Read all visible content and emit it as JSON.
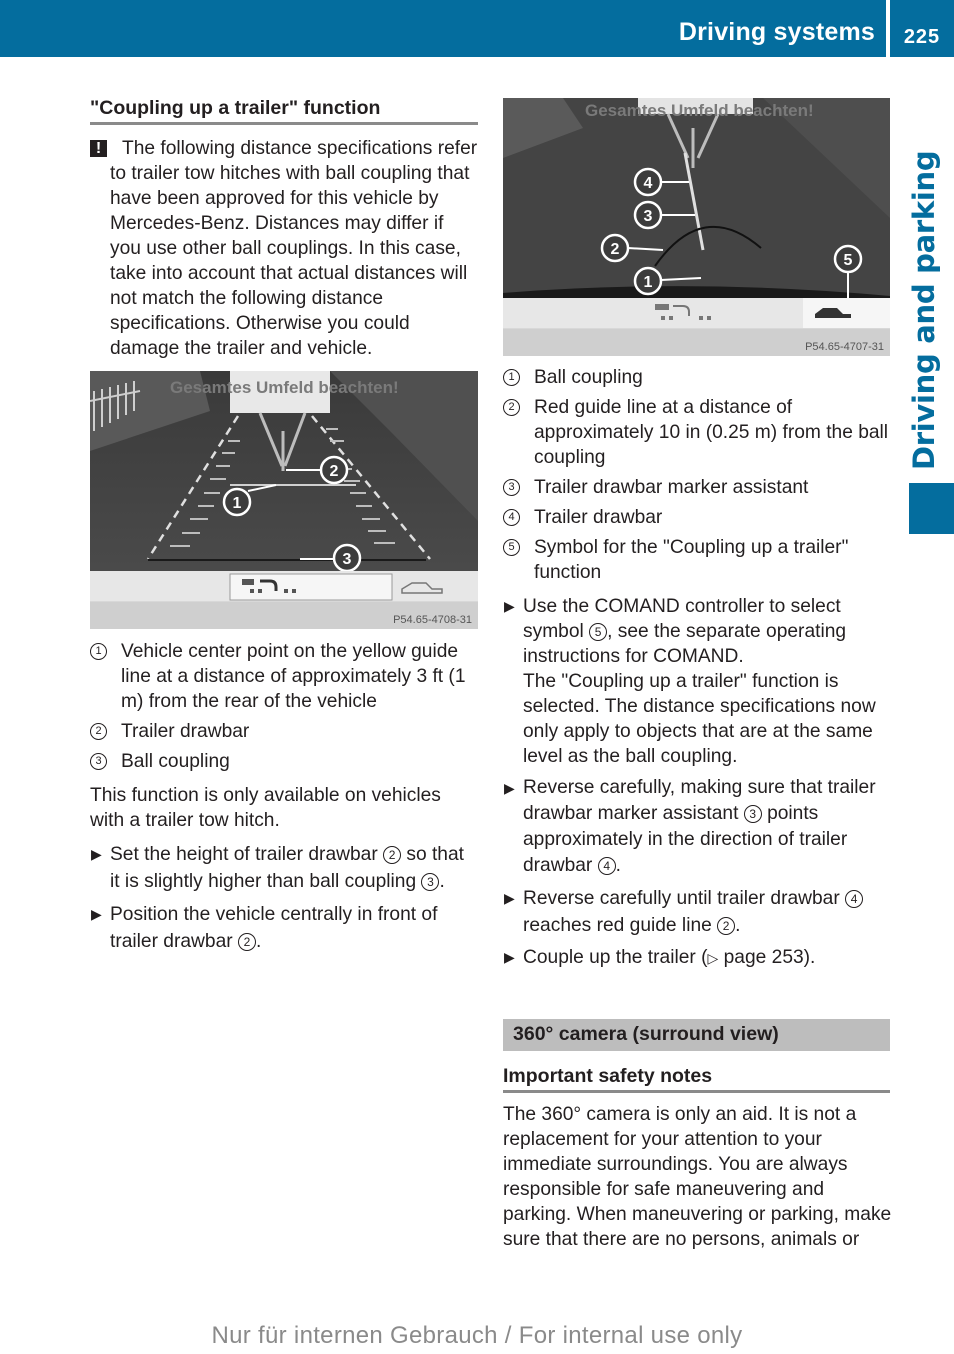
{
  "header": {
    "section_title": "Driving systems",
    "page_number": "225",
    "side_tab": "Driving and parking"
  },
  "left": {
    "heading": "\"Coupling up a trailer\" function",
    "warning_icon": "!",
    "warning_text": "The following distance specifications refer to trailer tow hitches with ball coupling that have been approved for this vehicle by Mercedes-Benz. Distances may differ if you use other ball couplings. In this case, take into account that actual distances will not match the following distance specifications. Otherwise you could damage the trailer and vehicle.",
    "figure": {
      "overlay_text": "Gesamtes Umfeld beachten!",
      "figure_code": "P54.65-4708-31",
      "callouts": [
        "1",
        "2",
        "3"
      ]
    },
    "legend": [
      {
        "num": "1",
        "text": "Vehicle center point on the yellow guide line at a distance of approximately 3 ft (1 m) from the rear of the vehicle"
      },
      {
        "num": "2",
        "text": "Trailer drawbar"
      },
      {
        "num": "3",
        "text": "Ball coupling"
      }
    ],
    "intro": "This function is only available on vehicles with a trailer tow hitch.",
    "steps": [
      {
        "before": "Set the height of trailer drawbar ",
        "ref1": "2",
        "middle": " so that it is slightly higher than ball coupling ",
        "ref2": "3",
        "after": "."
      },
      {
        "before": "Position the vehicle centrally in front of trailer drawbar ",
        "ref1": "2",
        "after": "."
      }
    ]
  },
  "right": {
    "figure": {
      "overlay_text": "Gesamtes Umfeld beachten!",
      "figure_code": "P54.65-4707-31",
      "callouts": [
        "1",
        "2",
        "3",
        "4",
        "5"
      ]
    },
    "legend": [
      {
        "num": "1",
        "text": "Ball coupling"
      },
      {
        "num": "2",
        "text": "Red guide line at a distance of approximately 10 in (0.25 m) from the ball coupling"
      },
      {
        "num": "3",
        "text": "Trailer drawbar marker assistant"
      },
      {
        "num": "4",
        "text": "Trailer drawbar"
      },
      {
        "num": "5",
        "text": "Symbol for the \"Coupling up a trailer\" function"
      }
    ],
    "steps": [
      {
        "before": "Use the COMAND controller to select symbol ",
        "ref1": "5",
        "after": ", see the separate operating instructions for COMAND.",
        "result": "The \"Coupling up a trailer\" function is selected. The distance specifications now only apply to objects that are at the same level as the ball coupling."
      },
      {
        "before": "Reverse carefully, making sure that trailer drawbar marker assistant ",
        "ref1": "3",
        "middle": " points approximately in the direction of trailer drawbar ",
        "ref2": "4",
        "after": "."
      },
      {
        "before": "Reverse carefully until trailer drawbar ",
        "ref1": "4",
        "middle": " reaches red guide line ",
        "ref2": "2",
        "after": "."
      },
      {
        "before": "Couple up the trailer (",
        "pageref_icon": "▷",
        "pageref": " page 253",
        "after": ")."
      }
    ],
    "section_title": "360° camera (surround view)",
    "subheading": "Important safety notes",
    "body": "The 360° camera is only an aid. It is not a replacement for your attention to your immediate surroundings. You are always responsible for safe maneuvering and parking. When maneuvering or parking, make sure that there are no persons, animals or"
  },
  "footer": {
    "note": "Nur für internen Gebrauch / For internal use only"
  }
}
